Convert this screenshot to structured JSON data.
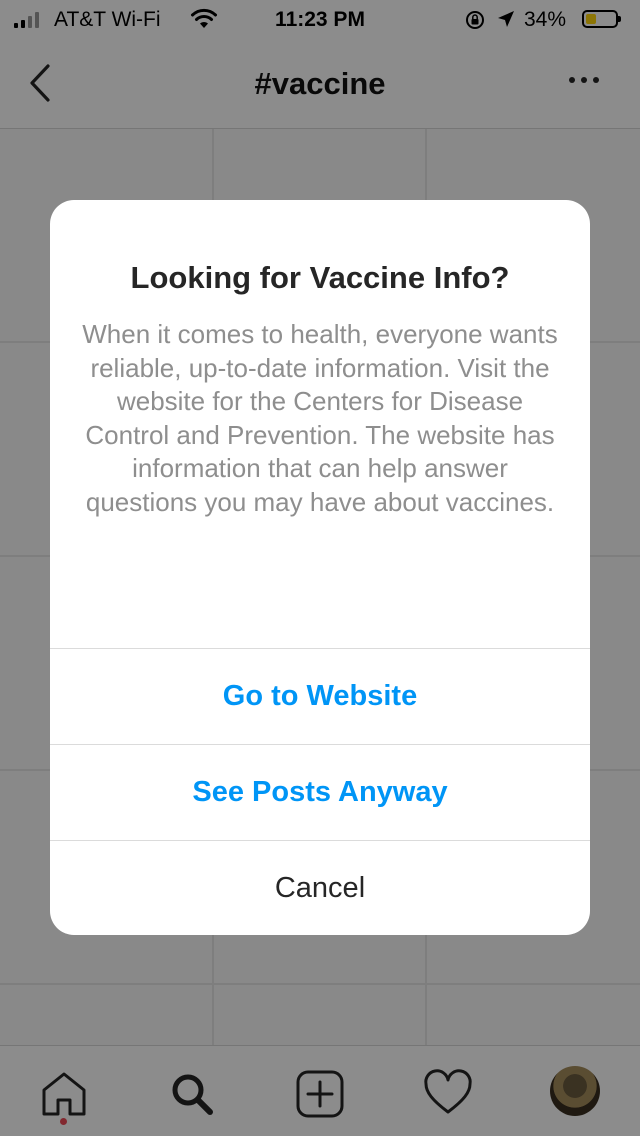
{
  "status_bar": {
    "carrier": "AT&T Wi-Fi",
    "time": "11:23 PM",
    "battery_percent": "34%",
    "battery_level": 0.34,
    "battery_color": "#ffd60a"
  },
  "nav": {
    "title": "#vaccine",
    "back_icon": "chevron-left-icon",
    "more_icon": "ellipsis-icon"
  },
  "dialog": {
    "title": "Looking for Vaccine Info?",
    "body": "When it comes to health, everyone wants reliable, up-to-date information. Visit the website for the Centers for Disease Control and Prevention. The website has information that can help answer questions you may have about vaccines.",
    "buttons": [
      {
        "label": "Go to Website"
      },
      {
        "label": "See Posts Anyway"
      },
      {
        "label": "Cancel"
      }
    ]
  },
  "tab_bar": {
    "items": [
      "home-icon",
      "search-icon",
      "new-post-icon",
      "heart-icon",
      "profile-avatar"
    ]
  },
  "colors": {
    "accent": "#0095f6",
    "notification_dot": "#ed4956"
  }
}
